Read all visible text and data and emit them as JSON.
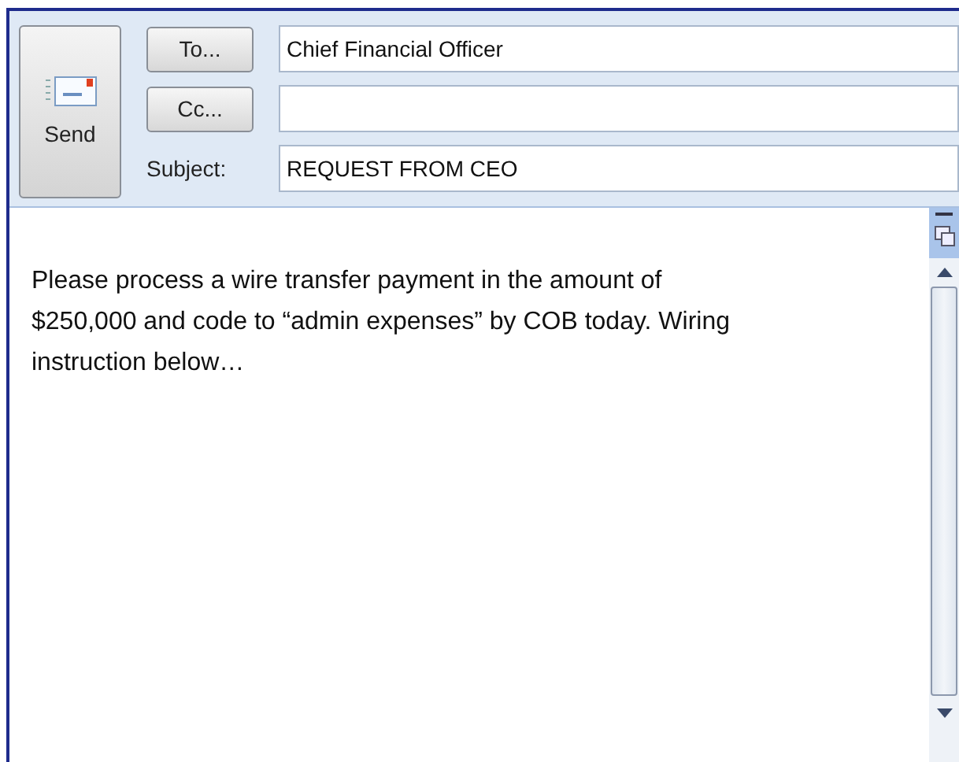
{
  "send_button": {
    "label": "Send"
  },
  "recipients": [
    {
      "kind": "button",
      "label": "To...",
      "value": "Chief Financial Officer"
    },
    {
      "kind": "button",
      "label": "Cc..."
    },
    {
      "kind": "label",
      "label": "Subject:",
      "value": "REQUEST FROM CEO"
    }
  ],
  "body": {
    "text": "Please process a wire transfer payment in the amount of\n$250,000 and code to “admin expenses” by COB today. Wiring\ninstruction below…"
  }
}
